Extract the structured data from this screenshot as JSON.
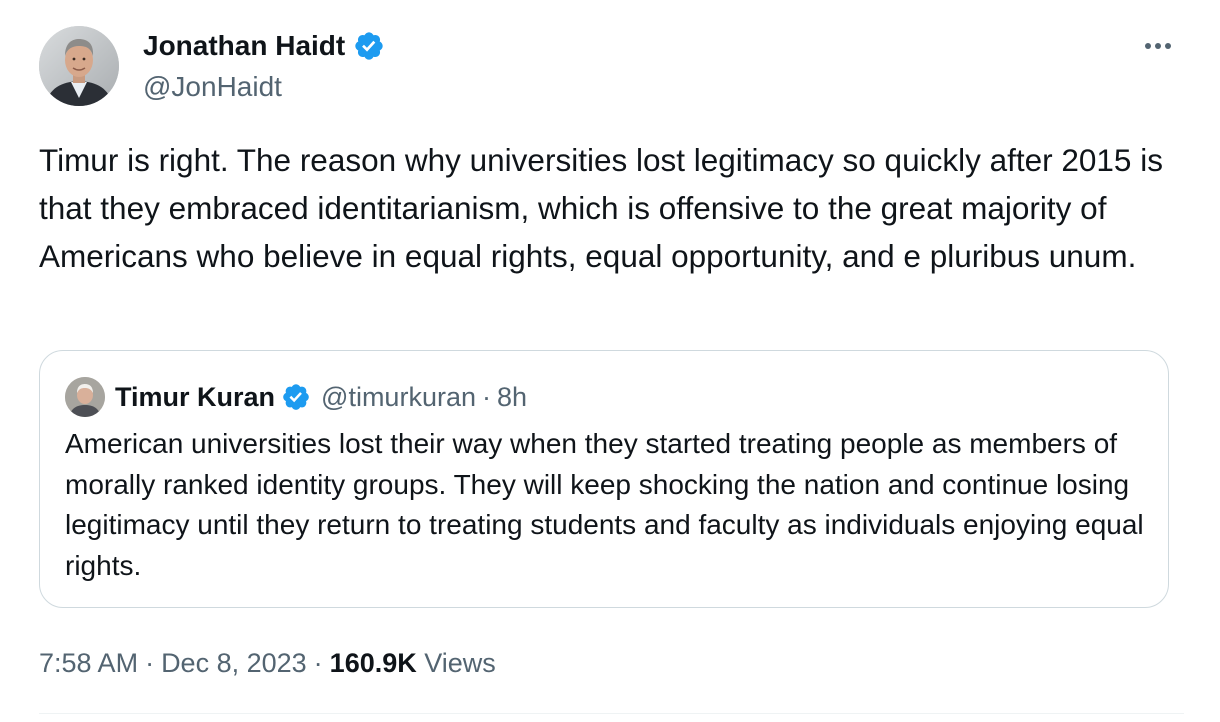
{
  "author": {
    "name": "Jonathan Haidt",
    "handle": "@JonHaidt",
    "verified": true
  },
  "tweet": {
    "text": "Timur is right. The reason why universities lost legitimacy so quickly after 2015 is that they embraced identitarianism, which is offensive to the great majority of Americans who believe in equal rights, equal opportunity, and e pluribus unum."
  },
  "quoted_tweet": {
    "name": "Timur Kuran",
    "handle": "@timurkuran",
    "separator": "·",
    "time": "8h",
    "verified": true,
    "text": "American universities lost their way when they started treating people as members of morally ranked identity groups. They will keep shocking the nation and continue losing legitimacy until they return to treating students and faculty as individuals enjoying equal rights."
  },
  "meta": {
    "time": "7:58 AM",
    "separator": "·",
    "date": "Dec 8, 2023",
    "views_count": "160.9K",
    "views_label": "Views"
  },
  "colors": {
    "verified_blue": "#1d9bf0",
    "secondary_text": "#536471",
    "primary_text": "#0f1419",
    "border": "#cfd9de"
  },
  "icons": {
    "verified": "verified-badge-icon",
    "more": "more-dots-icon"
  }
}
